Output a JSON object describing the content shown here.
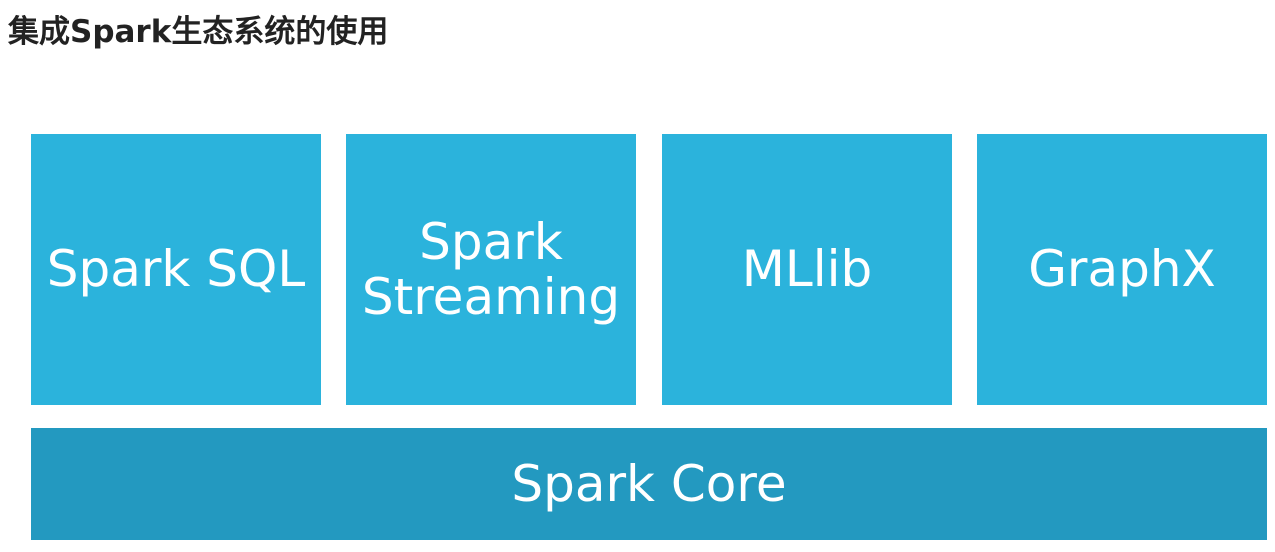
{
  "title": "集成Spark生态系统的使用",
  "components": [
    {
      "label": "Spark SQL"
    },
    {
      "label": "Spark Streaming"
    },
    {
      "label": "MLlib"
    },
    {
      "label": "GraphX"
    }
  ],
  "core": {
    "label": "Spark Core"
  },
  "colors": {
    "component": "#2bb3dc",
    "core": "#2399c0"
  }
}
